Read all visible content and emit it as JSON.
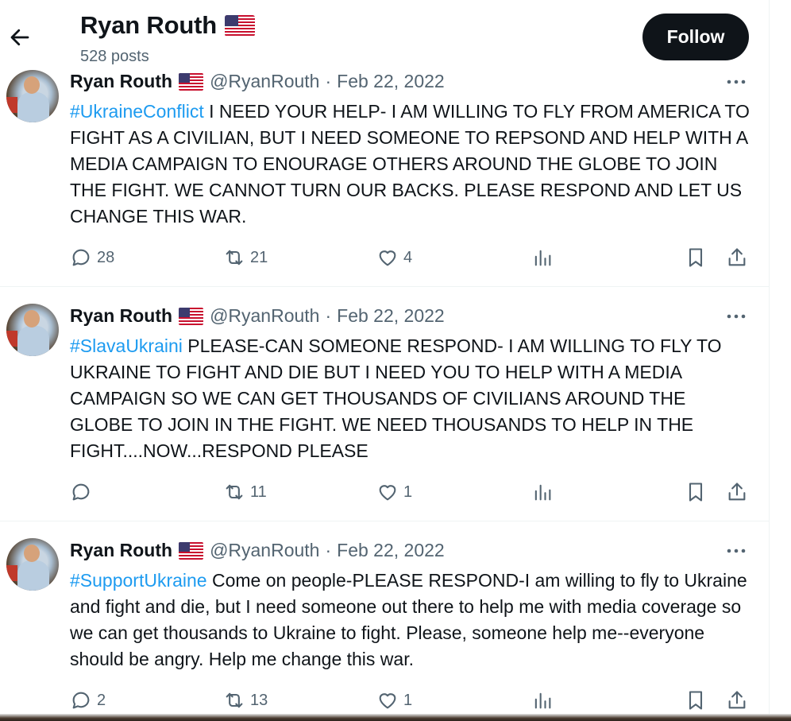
{
  "header": {
    "name": "Ryan Routh",
    "post_count": "528 posts",
    "follow_label": "Follow"
  },
  "tweets": [
    {
      "name": "Ryan Routh",
      "handle": "@RyanRouth",
      "separator": "·",
      "date": "Feb 22, 2022",
      "hashtag": "#UkraineConflict",
      "body": " I NEED YOUR HELP- I AM WILLING TO FLY FROM AMERICA TO FIGHT AS A CIVILIAN, BUT I NEED SOMEONE TO REPSOND AND HELP WITH A MEDIA CAMPAIGN TO ENOURAGE OTHERS AROUND THE GLOBE TO JOIN THE FIGHT. WE CANNOT TURN OUR BACKS.  PLEASE RESPOND AND LET US CHANGE THIS WAR.",
      "replies": "28",
      "reposts": "21",
      "likes": "4"
    },
    {
      "name": "Ryan Routh",
      "handle": "@RyanRouth",
      "separator": "·",
      "date": "Feb 22, 2022",
      "hashtag": "#SlavaUkraini",
      "body": " PLEASE-CAN SOMEONE RESPOND- I AM WILLING TO FLY TO UKRAINE TO FIGHT AND DIE BUT I NEED YOU TO HELP WITH A MEDIA CAMPAIGN SO WE CAN GET THOUSANDS OF CIVILIANS AROUND THE GLOBE TO JOIN IN THE FIGHT.  WE NEED THOUSANDS TO HELP IN THE FIGHT....NOW...RESPOND PLEASE",
      "replies": "",
      "reposts": "11",
      "likes": "1"
    },
    {
      "name": "Ryan Routh",
      "handle": "@RyanRouth",
      "separator": "·",
      "date": "Feb 22, 2022",
      "hashtag": "#SupportUkraine",
      "body": " Come on people-PLEASE RESPOND-I am willing to fly to Ukraine and fight and die, but I need someone out there to help me with media coverage so we can get thousands to Ukraine to fight.  Please, someone help me--everyone should be angry.  Help me change this war.",
      "replies": "2",
      "reposts": "13",
      "likes": "1"
    }
  ],
  "icons": {
    "back": "back-arrow-icon",
    "flag": "us-flag-icon",
    "more": "more-icon",
    "reply": "reply-icon",
    "repost": "repost-icon",
    "like": "like-icon",
    "views": "views-icon",
    "bookmark": "bookmark-icon",
    "share": "share-icon"
  },
  "colors": {
    "link": "#1d9bf0",
    "text": "#0f1419",
    "secondary": "#536471",
    "button_bg": "#0f1419"
  }
}
